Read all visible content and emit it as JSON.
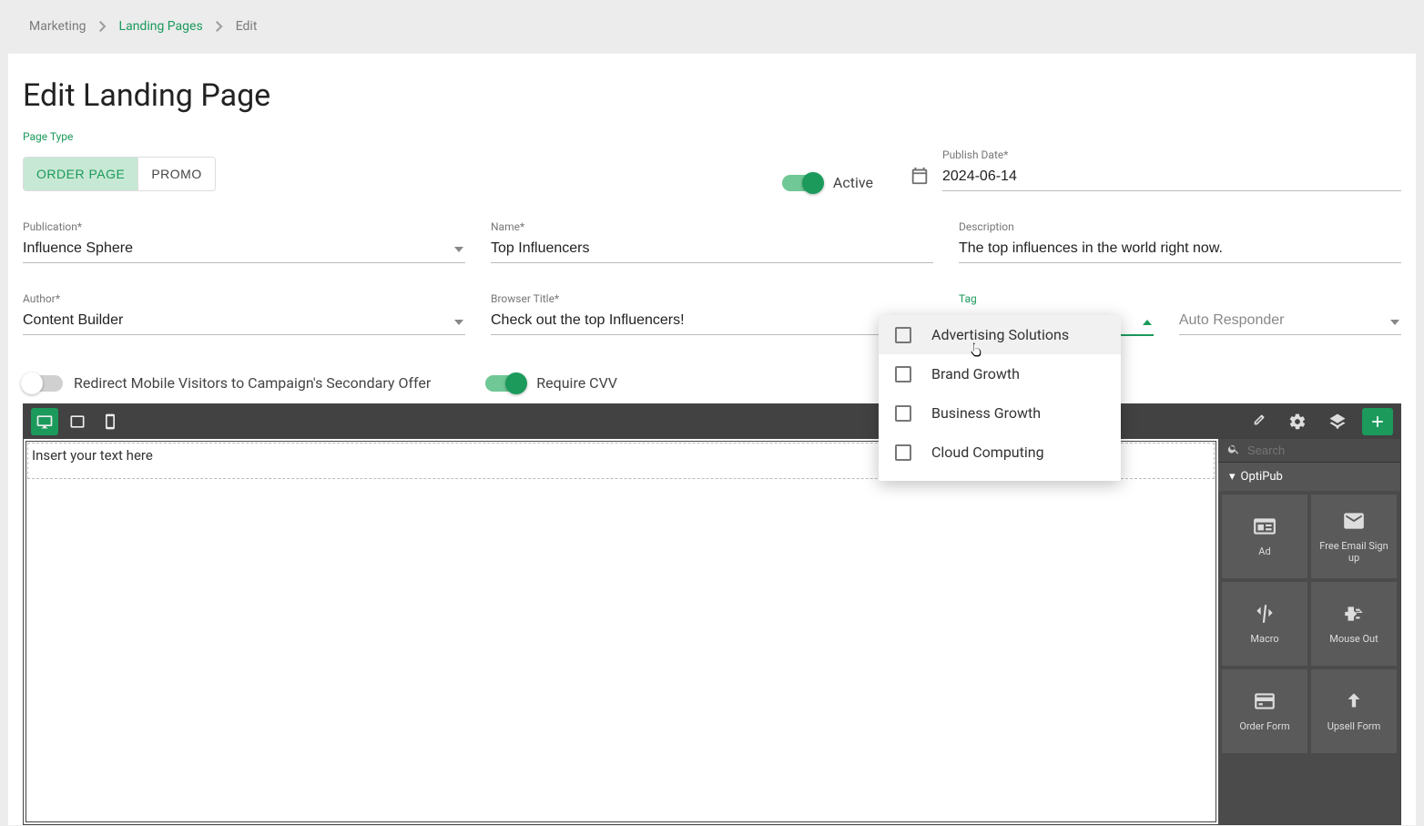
{
  "breadcrumb": {
    "root": "Marketing",
    "parent": "Landing Pages",
    "current": "Edit"
  },
  "page_title": "Edit Landing Page",
  "section": {
    "page_type_label": "Page Type",
    "tab_order": "ORDER PAGE",
    "tab_promo": "PROMO",
    "active_label": "Active",
    "publish_date_label": "Publish Date*",
    "publish_date_value": "2024-06-14"
  },
  "fields": {
    "publication_label": "Publication*",
    "publication_value": "Influence Sphere",
    "name_label": "Name*",
    "name_value": "Top Influencers",
    "description_label": "Description",
    "description_value": "The top influences in the world right now.",
    "author_label": "Author*",
    "author_value": "Content Builder",
    "browser_title_label": "Browser Title*",
    "browser_title_value": "Check out the top Influencers!",
    "tag_label": "Tag",
    "autoresponder_value": "Auto Responder"
  },
  "toggles": {
    "redirect_label": "Redirect Mobile Visitors to Campaign's Secondary Offer",
    "require_cvv_label": "Require CVV"
  },
  "tag_dropdown": {
    "options": [
      "Advertising Solutions",
      "Brand Growth",
      "Business Growth",
      "Cloud Computing"
    ]
  },
  "editor": {
    "placeholder": "Insert your text here",
    "search_placeholder": "Search",
    "group_name": "OptiPub",
    "components": [
      "Ad",
      "Free Email Sign up",
      "Macro",
      "Mouse Out",
      "Order Form",
      "Upsell Form"
    ]
  }
}
